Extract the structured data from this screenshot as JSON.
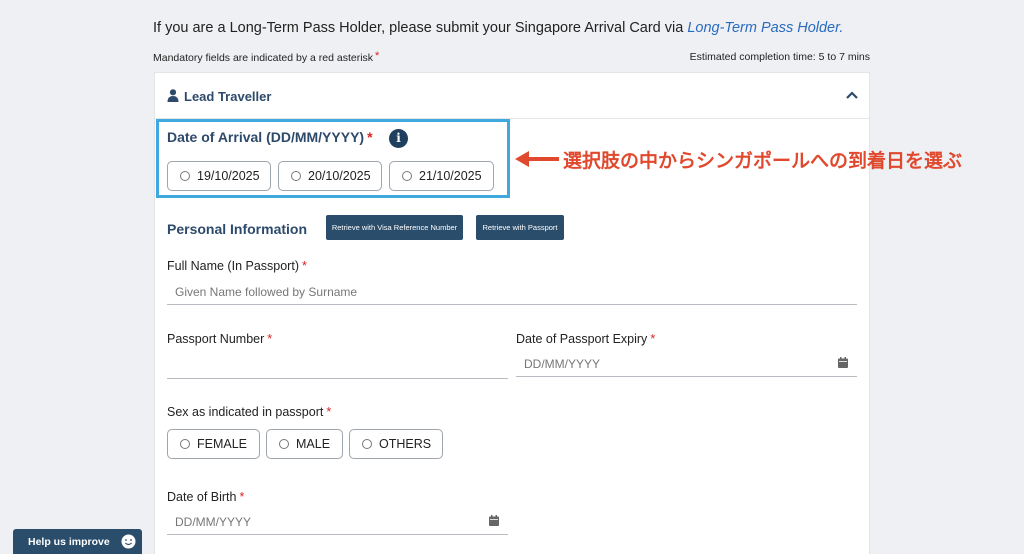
{
  "intro": {
    "text": "If you are a Long-Term Pass Holder, please submit your Singapore Arrival Card via ",
    "link": "Long-Term Pass Holder."
  },
  "mandatory_note": "Mandatory fields are indicated by a red asterisk",
  "asterisk": "*",
  "estimate": "Estimated completion time: 5 to 7 mins",
  "section": {
    "title": "Lead Traveller",
    "icon": "person-icon",
    "toggle_icon": "chevron-up-icon"
  },
  "arrival": {
    "label": "Date of Arrival (DD/MM/YYYY)",
    "info_icon": "i",
    "options": [
      "19/10/2025",
      "20/10/2025",
      "21/10/2025"
    ]
  },
  "annotation": {
    "text": "選択肢の中からシンガポールへの到着日を選ぶ",
    "color": "#e1492e",
    "highlight_color": "#3ea8df"
  },
  "personal": {
    "title": "Personal Information",
    "retrieve_visa": "Retrieve with Visa Reference Number",
    "retrieve_passport": "Retrieve with Passport"
  },
  "fields": {
    "full_name": {
      "label": "Full Name (In Passport)",
      "placeholder": "Given Name followed by Surname"
    },
    "passport_number": {
      "label": "Passport Number",
      "placeholder": ""
    },
    "passport_expiry": {
      "label": "Date of Passport Expiry",
      "placeholder": "DD/MM/YYYY",
      "icon": "calendar-icon"
    },
    "sex": {
      "label": "Sex as indicated in passport",
      "options": [
        "FEMALE",
        "MALE",
        "OTHERS"
      ]
    },
    "dob": {
      "label": "Date of Birth",
      "placeholder": "DD/MM/YYYY",
      "icon": "calendar-icon"
    }
  },
  "help": {
    "label": "Help us improve",
    "icon": "smiley-icon"
  },
  "colors": {
    "primary": "#2a4d6b",
    "heading": "#2d4a6b",
    "link": "#2a6bc0",
    "required": "#dd2222"
  }
}
